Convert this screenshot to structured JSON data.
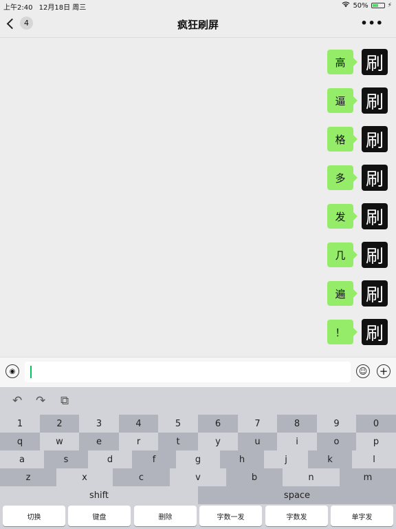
{
  "status_bar": {
    "time": "上午2:40",
    "date": "12月18日 周三",
    "battery": "50%",
    "battery_level": 0.5
  },
  "nav": {
    "back_badge": "4",
    "title": "疯狂刷屏",
    "more": "•••"
  },
  "messages": [
    {
      "text": "高",
      "avatar": "刷"
    },
    {
      "text": "逼",
      "avatar": "刷"
    },
    {
      "text": "格",
      "avatar": "刷"
    },
    {
      "text": "多",
      "avatar": "刷"
    },
    {
      "text": "发",
      "avatar": "刷"
    },
    {
      "text": "几",
      "avatar": "刷"
    },
    {
      "text": "遍",
      "avatar": "刷"
    },
    {
      "text": "！",
      "avatar": "刷"
    }
  ],
  "input": {
    "value": ""
  },
  "keyboard": {
    "toolbar": {
      "undo": "↶",
      "redo": "↷",
      "clipboard": "⧉"
    },
    "rows": [
      [
        "1",
        "2",
        "3",
        "4",
        "5",
        "6",
        "7",
        "8",
        "9",
        "0"
      ],
      [
        "q",
        "w",
        "e",
        "r",
        "t",
        "y",
        "u",
        "i",
        "o",
        "p"
      ],
      [
        "a",
        "s",
        "d",
        "f",
        "g",
        "h",
        "j",
        "k",
        "l"
      ],
      [
        "z",
        "x",
        "c",
        "v",
        "b",
        "n",
        "m"
      ],
      [
        "shift",
        "space"
      ]
    ],
    "bottom": [
      "切换",
      "键盘",
      "删除",
      "字数一发",
      "字数发",
      "单字发"
    ]
  },
  "colors": {
    "bubble": "#95ec69",
    "avatar_bg": "#111111",
    "caret": "#07c160",
    "key_dark": "#b1b4bc",
    "key_light": "#d1d3d9"
  }
}
